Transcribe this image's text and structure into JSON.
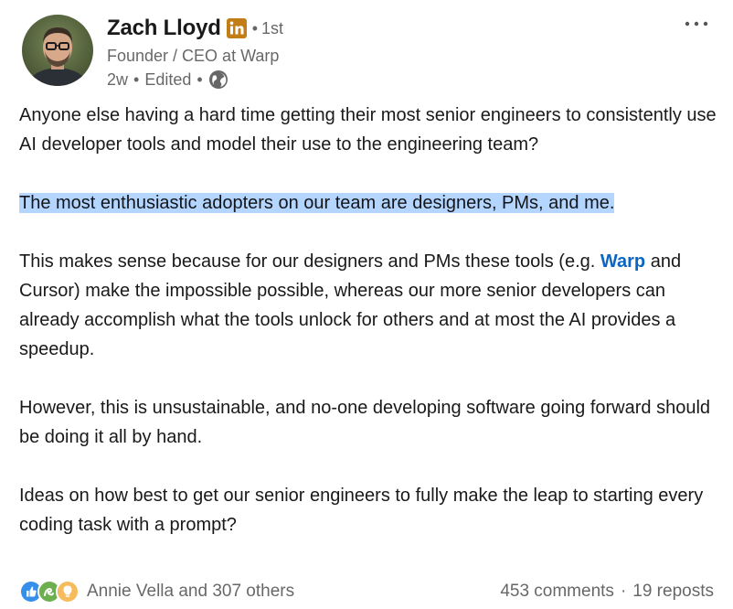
{
  "author": {
    "name": "Zach Lloyd",
    "degree": "1st",
    "degree_separator": "•",
    "headline": "Founder / CEO at Warp",
    "time": "2w",
    "edited": "Edited",
    "meta_separator": "•"
  },
  "icons": {
    "badge": "linkedin-badge-icon",
    "visibility": "globe-icon",
    "menu": "more-horizontal-icon",
    "reactions": [
      "like-icon",
      "celebrate-icon",
      "insightful-icon"
    ]
  },
  "colors": {
    "link": "#0a66c2",
    "highlight": "#b4d5fe",
    "badge": "#c37d16"
  },
  "post": {
    "p1": "Anyone else having a hard time getting their most senior engineers to consistently use AI developer tools and model their use to the engineering team?",
    "p2": "The most enthusiastic adopters on our team are designers, PMs, and me.",
    "p3_before": "This makes sense because for our designers and PMs these tools (e.g. ",
    "p3_mention": "Warp",
    "p3_after": " and Cursor) make the impossible possible, whereas our more senior developers can already accomplish what the tools unlock for others and at most the AI provides a speedup.",
    "p4": "However, this is unsustainable, and no-one developing software going forward should be doing it all by hand.",
    "p5": "Ideas on how best to get our senior engineers to fully make the leap to starting every coding task with a prompt?"
  },
  "social": {
    "reactions_text": "Annie Vella and 307 others",
    "comments": "453 comments",
    "separator": "·",
    "reposts": "19 reposts"
  }
}
